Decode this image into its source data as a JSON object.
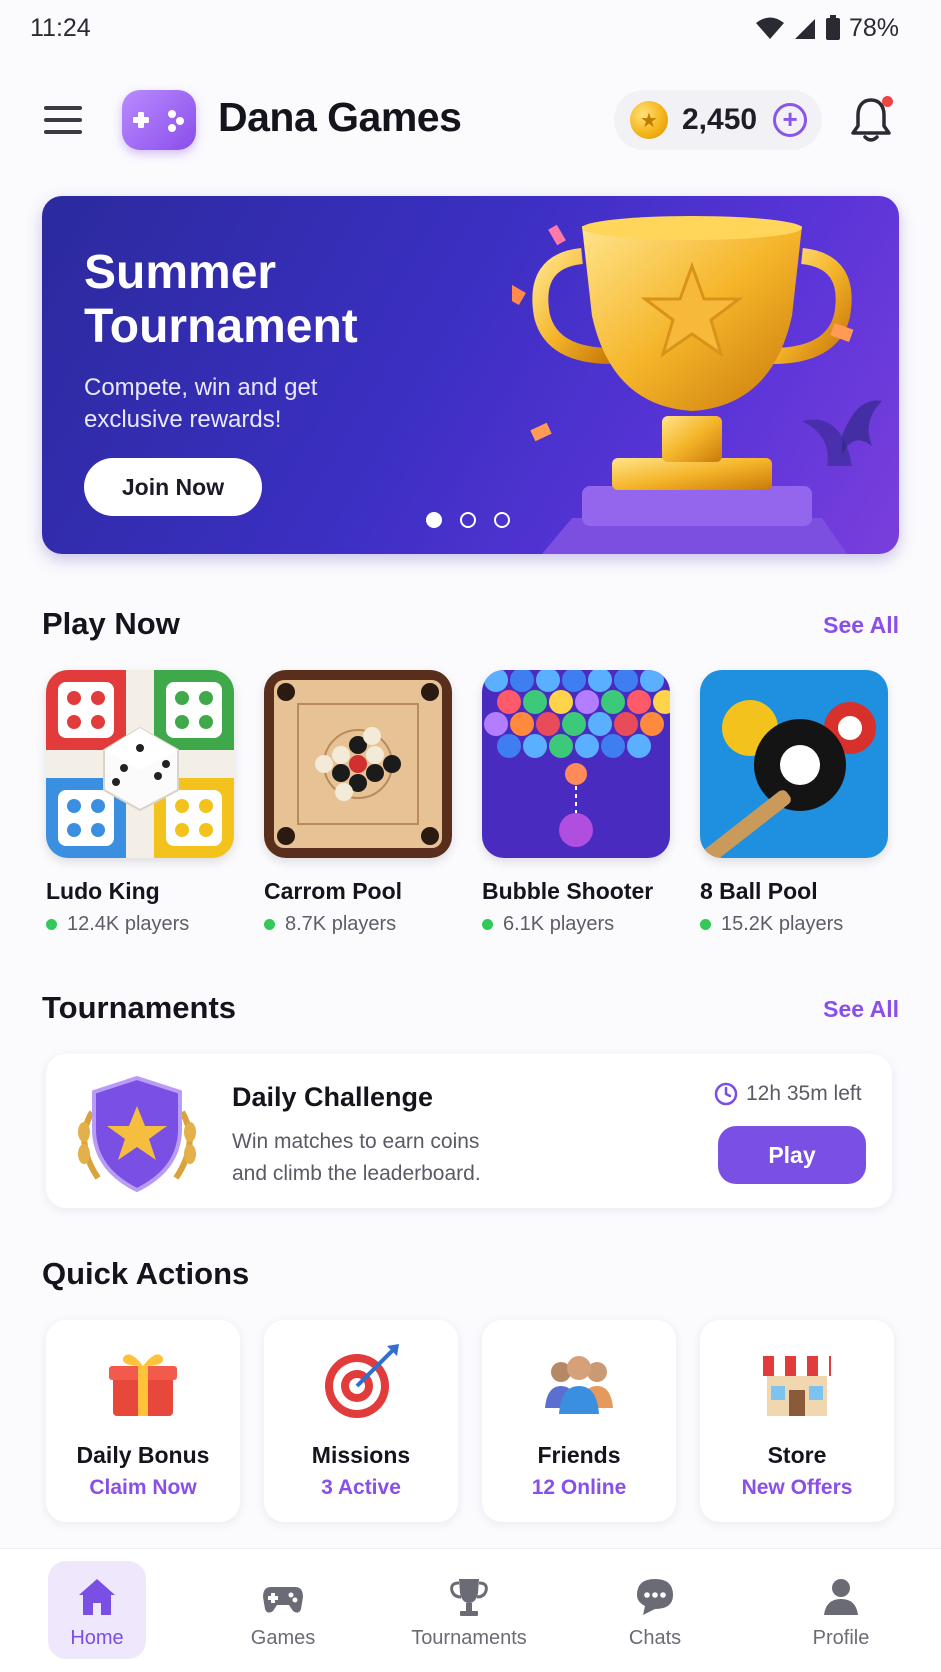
{
  "status_bar": {
    "time": "11:24",
    "battery": "78%"
  },
  "header": {
    "app_name": "Dana Games",
    "coins": "2,450",
    "has_notification": true
  },
  "banner": {
    "title": "Summer Tournament",
    "subtitle": "Compete, win and get exclusive rewards!",
    "button": "Join Now",
    "slides": 3,
    "active_slide": 1
  },
  "play_now": {
    "title": "Play Now",
    "see_all": "See All",
    "games": [
      {
        "name": "Ludo King",
        "players": "12.4K players",
        "icon": "ludo-board-icon"
      },
      {
        "name": "Carrom Pool",
        "players": "8.7K players",
        "icon": "carrom-board-icon"
      },
      {
        "name": "Bubble Shooter",
        "players": "6.1K players",
        "icon": "bubble-shooter-icon"
      },
      {
        "name": "8 Ball Pool",
        "players": "15.2K players",
        "icon": "eight-ball-icon"
      }
    ]
  },
  "tournaments": {
    "title": "Tournaments",
    "see_all": "See All",
    "card": {
      "title": "Daily Challenge",
      "description": "Win matches to earn coins and climb the leaderboard.",
      "time_left": "12h 35m left",
      "button": "Play"
    }
  },
  "quick_actions": {
    "title": "Quick Actions",
    "items": [
      {
        "label": "Daily Bonus",
        "sub": "Claim Now",
        "icon": "gift-icon"
      },
      {
        "label": "Missions",
        "sub": "3 Active",
        "icon": "target-icon"
      },
      {
        "label": "Friends",
        "sub": "12 Online",
        "icon": "friends-icon"
      },
      {
        "label": "Store",
        "sub": "New Offers",
        "icon": "store-icon"
      }
    ]
  },
  "bottom_nav": {
    "items": [
      {
        "label": "Home",
        "icon": "home-icon",
        "active": true
      },
      {
        "label": "Games",
        "icon": "gamepad-icon",
        "active": false
      },
      {
        "label": "Tournaments",
        "icon": "trophy-icon",
        "active": false
      },
      {
        "label": "Chats",
        "icon": "chat-icon",
        "active": false
      },
      {
        "label": "Profile",
        "icon": "profile-icon",
        "active": false
      }
    ]
  },
  "colors": {
    "accent": "#7a4fe3",
    "banner_start": "#2b2a9d",
    "banner_end": "#7a3fdc",
    "online": "#34c759"
  }
}
